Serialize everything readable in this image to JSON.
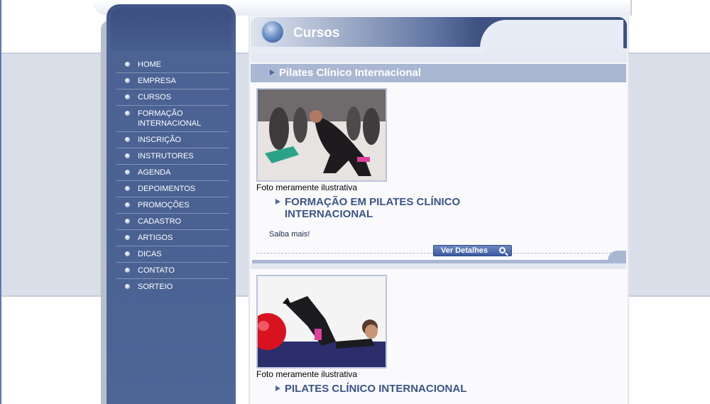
{
  "nav": {
    "items": [
      {
        "label": "HOME"
      },
      {
        "label": "EMPRESA"
      },
      {
        "label": "CURSOS"
      },
      {
        "label": "FORMAÇÃO\nINTERNACIONAL"
      },
      {
        "label": "INSCRIÇÃO"
      },
      {
        "label": "INSTRUTORES"
      },
      {
        "label": "AGENDA"
      },
      {
        "label": "DEPOIMENTOS"
      },
      {
        "label": "PROMOÇÕES"
      },
      {
        "label": "CADASTRO"
      },
      {
        "label": "ARTIGOS"
      },
      {
        "label": "DICAS"
      },
      {
        "label": "CONTATO"
      },
      {
        "label": "SORTEIO"
      }
    ]
  },
  "page": {
    "title": "Cursos",
    "title_icon": "globe-icon",
    "section_heading": "Pilates Clínico Internacional"
  },
  "courses": [
    {
      "caption": "Foto meramente ilustrativa",
      "title": "FORMAÇÃO EM PILATES CLÍNICO INTERNACIONAL",
      "more_label": "Saiba mais!",
      "details_button": "Ver Detalhes"
    },
    {
      "caption": "Foto meramente ilustrativa",
      "title": "PILATES CLÍNICO INTERNACIONAL"
    }
  ],
  "colors": {
    "sidebar": "#4a6192",
    "accent": "#3b5486",
    "section_bar": "#aab7d3"
  }
}
